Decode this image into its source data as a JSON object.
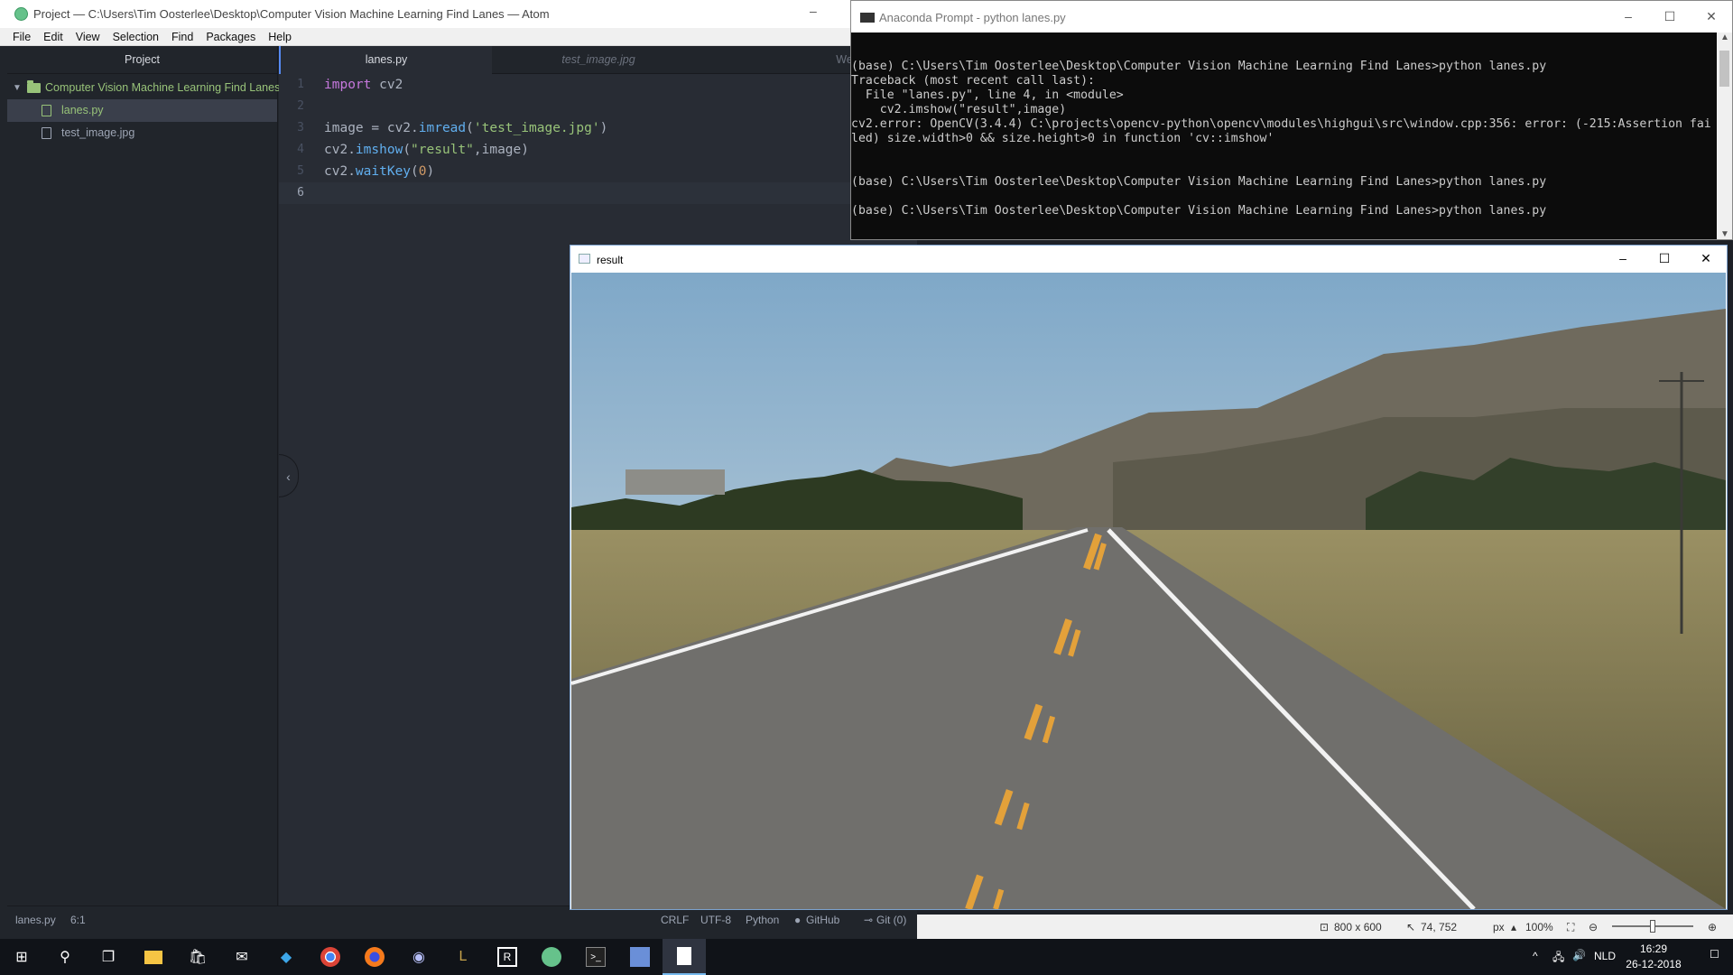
{
  "atom": {
    "title": "Project — C:\\Users\\Tim Oosterlee\\Desktop\\Computer Vision Machine Learning Find Lanes — Atom",
    "menu": [
      "File",
      "Edit",
      "View",
      "Selection",
      "Find",
      "Packages",
      "Help"
    ],
    "tree": {
      "header": "Project",
      "root": "Computer Vision Machine Learning Find Lanes",
      "files": [
        "lanes.py",
        "test_image.jpg"
      ]
    },
    "tabs": [
      "lanes.py",
      "test_image.jpg",
      "Welcome Guide"
    ],
    "code": {
      "line_numbers": [
        "1",
        "2",
        "3",
        "4",
        "5",
        "6"
      ],
      "l1_kw": "import",
      "l1_rest": " cv2",
      "l3_a": "image = cv2.",
      "l3_fn": "imread",
      "l3_b": "(",
      "l3_str": "'test_image.jpg'",
      "l3_c": ")",
      "l4_a": "cv2.",
      "l4_fn": "imshow",
      "l4_b": "(",
      "l4_str": "\"result\"",
      "l4_c": ",image)",
      "l5_a": "cv2.",
      "l5_fn": "waitKey",
      "l5_b": "(",
      "l5_num": "0",
      "l5_c": ")"
    },
    "status": {
      "file": "lanes.py",
      "cursor": "6:1",
      "line_ending": "CRLF",
      "encoding": "UTF-8",
      "grammar": "Python",
      "github": "GitHub",
      "git": "Git (0)"
    }
  },
  "prompt": {
    "title": "Anaconda Prompt - python  lanes.py",
    "lines": [
      "(base) C:\\Users\\Tim Oosterlee\\Desktop\\Computer Vision Machine Learning Find Lanes>python lanes.py",
      "Traceback (most recent call last):",
      "  File \"lanes.py\", line 4, in <module>",
      "    cv2.imshow(\"result\",image)",
      "cv2.error: OpenCV(3.4.4) C:\\projects\\opencv-python\\opencv\\modules\\highgui\\src\\window.cpp:356: error: (-215:Assertion fai",
      "led) size.width>0 && size.height>0 in function 'cv::imshow'",
      "",
      "",
      "(base) C:\\Users\\Tim Oosterlee\\Desktop\\Computer Vision Machine Learning Find Lanes>python lanes.py",
      "",
      "(base) C:\\Users\\Tim Oosterlee\\Desktop\\Computer Vision Machine Learning Find Lanes>python lanes.py"
    ]
  },
  "result_window": {
    "title": "result"
  },
  "viewer": {
    "dimensions": "800 x 600",
    "position": "74, 752",
    "unit": "px",
    "zoom": "100%"
  },
  "taskbar": {
    "icons": [
      "windows-start-icon",
      "search-icon",
      "task-view-icon",
      "file-explorer-icon",
      "store-icon",
      "mail-icon",
      "visual-studio-icon",
      "chrome-icon",
      "firefox-icon",
      "discord-icon",
      "league-icon",
      "r-icon",
      "atom-icon",
      "terminal-icon",
      "paint-icon",
      "notepad-icon"
    ],
    "language": "NLD",
    "time": "16:29",
    "date": "26-12-2018"
  },
  "colors": {
    "atom_bg": "#282c34",
    "accent_green": "#98c379",
    "accent_blue": "#568af2",
    "prompt_bg": "#0c0c0c"
  }
}
